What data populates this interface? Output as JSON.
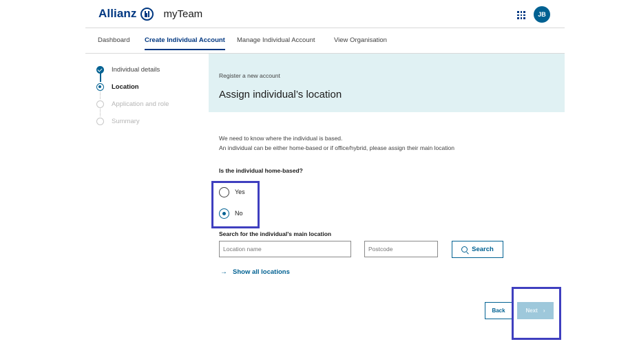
{
  "header": {
    "brand": "Allianz",
    "app_name": "myTeam",
    "avatar_initials": "JB"
  },
  "nav": {
    "items": [
      {
        "label": "Dashboard",
        "active": false
      },
      {
        "label": "Create Individual Account",
        "active": true
      },
      {
        "label": "Manage Individual Account",
        "active": false
      },
      {
        "label": "View Organisation",
        "active": false
      }
    ]
  },
  "stepper": {
    "steps": [
      {
        "label": "Individual details",
        "state": "done"
      },
      {
        "label": "Location",
        "state": "current"
      },
      {
        "label": "Application and role",
        "state": "todo"
      },
      {
        "label": "Summary",
        "state": "todo"
      }
    ]
  },
  "banner": {
    "subtitle": "Register a new account",
    "title": "Assign individual’s location"
  },
  "intro": {
    "line1": "We need to know where the individual is based.",
    "line2": "An individual can be either home-based or if office/hybrid, please assign their main location"
  },
  "home_based": {
    "question": "Is the individual home-based?",
    "options": [
      {
        "label": "Yes",
        "checked": false
      },
      {
        "label": "No",
        "checked": true
      }
    ]
  },
  "location_search": {
    "label": "Search for the individual’s main location",
    "location_placeholder": "Location name",
    "postcode_placeholder": "Postcode",
    "search_label": "Search",
    "show_all_label": "Show all locations"
  },
  "actions": {
    "back_label": "Back",
    "next_label": "Next",
    "next_chevron": "›"
  },
  "colors": {
    "brand_blue": "#003781",
    "accent": "#006192",
    "banner_bg": "#e0f1f3",
    "highlight": "#3f3fbf",
    "next_disabled": "#9ec8db"
  }
}
